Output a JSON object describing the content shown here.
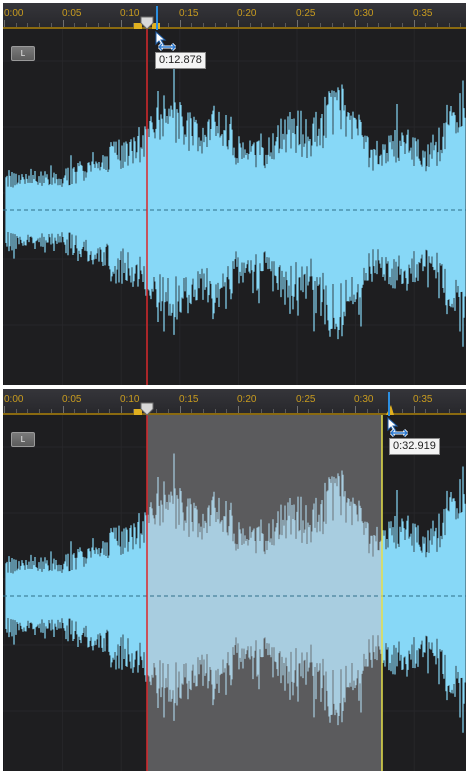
{
  "ruler": {
    "labels": [
      "0:00",
      "0:05",
      "0:10",
      "0:15",
      "0:20",
      "0:25",
      "0:30",
      "0:35"
    ]
  },
  "channel_label": "L",
  "panels": [
    {
      "id": "top",
      "tooltip": "0:12.878"
    },
    {
      "id": "bottom",
      "tooltip": "0:32.919"
    }
  ],
  "colors": {
    "waveform": "#87d8f7",
    "waveform_selected": "#a8cde0",
    "selection_bg": "#5b5b5d",
    "playhead": "#d8282c",
    "selection_end": "#e6e04a",
    "hover_marker": "#2c8fe0",
    "ruler_text": "#c99c1f"
  }
}
